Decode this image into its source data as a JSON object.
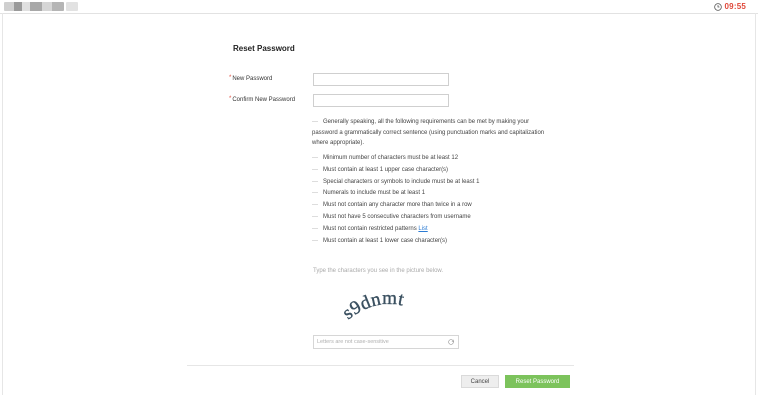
{
  "topbar": {
    "timer": "09:55",
    "timer_icon": "clock-icon",
    "accent_color": "#e0483a"
  },
  "form": {
    "title": "Reset Password",
    "required_marker": "*",
    "new_password_label": "New Password",
    "confirm_password_label": "Confirm New Password",
    "new_password_value": "",
    "confirm_password_value": ""
  },
  "requirements": {
    "intro": "Generally speaking, all the following requirements can be met by making your password a grammatically correct sentence (using punctuation marks and capitalization where appropriate).",
    "items": [
      "Minimum number of characters must be at least 12",
      "Must contain at least 1 upper case character(s)",
      "Special characters or symbols to include must be at least 1",
      "Numerals to include must be at least 1",
      "Must not contain any character more than twice in a row",
      "Must not have 5 consecutive characters from username",
      "Must not contain restricted patterns",
      "Must contain at least 1 lower case character(s)"
    ],
    "restricted_patterns_link": "List",
    "dash": "—"
  },
  "captcha": {
    "hint": "Type the characters you see in the picture below.",
    "image_text": "s9dnmt",
    "input_placeholder": "Letters are not case-sensitive",
    "input_value": "",
    "refresh_icon": "refresh-icon"
  },
  "buttons": {
    "cancel": "Cancel",
    "reset": "Reset Password",
    "reset_color": "#7cc35c"
  }
}
